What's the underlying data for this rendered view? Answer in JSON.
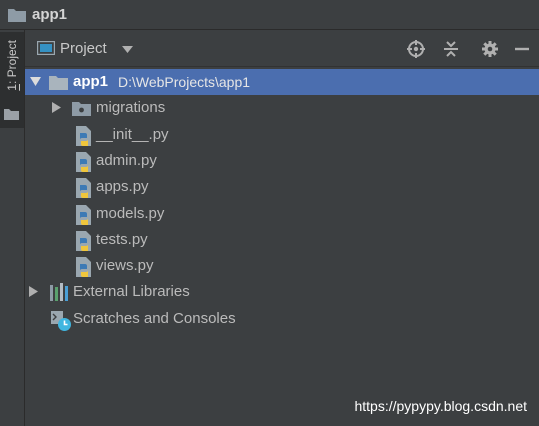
{
  "window": {
    "title": "app1"
  },
  "side_tab": {
    "number": "1",
    "label": ": Project"
  },
  "panel": {
    "view_label": "Project",
    "tools": [
      "locate-icon",
      "collapse-all-icon",
      "gear-icon",
      "hide-icon"
    ]
  },
  "tree": {
    "root": {
      "name": "app1",
      "path": "D:\\WebProjects\\app1",
      "expanded": true,
      "selected": true
    },
    "children": [
      {
        "name": "migrations",
        "type": "folder",
        "expanded": false
      },
      {
        "name": "__init__.py",
        "type": "python-file"
      },
      {
        "name": "admin.py",
        "type": "python-file"
      },
      {
        "name": "apps.py",
        "type": "python-file"
      },
      {
        "name": "models.py",
        "type": "python-file"
      },
      {
        "name": "tests.py",
        "type": "python-file"
      },
      {
        "name": "views.py",
        "type": "python-file"
      }
    ],
    "external_libraries": "External Libraries",
    "scratches": "Scratches and Consoles"
  },
  "watermark": "https://pypypy.blog.csdn.net",
  "colors": {
    "background": "#3c3f41",
    "selection": "#4b6eaf",
    "text": "#bbbbbb",
    "folder": "#8e9ba6"
  }
}
